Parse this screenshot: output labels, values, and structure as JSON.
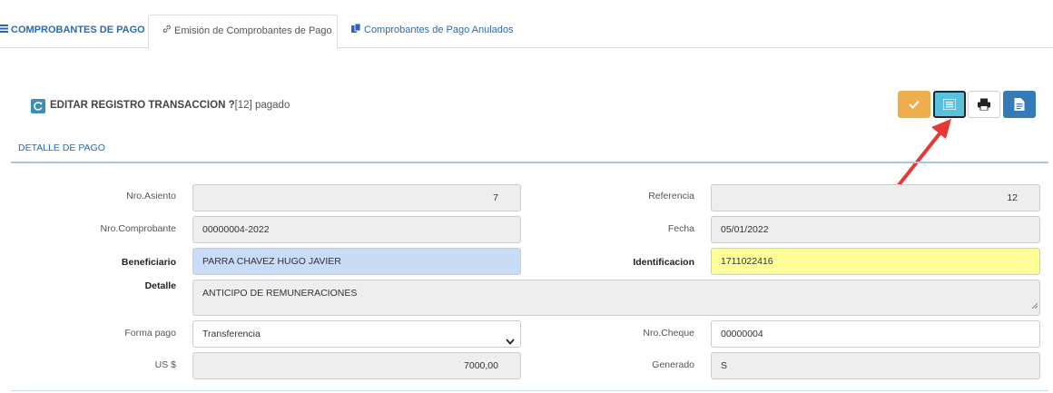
{
  "tabs": [
    {
      "label": "COMPROBANTES DE PAGO",
      "icon": "list-icon"
    },
    {
      "label": "Emisión de Comprobantes de Pago",
      "icon": "link-icon"
    },
    {
      "label": "Comprobantes de Pago Anulados",
      "icon": "copy-icon"
    }
  ],
  "header": {
    "title": "EDITAR REGISTRO TRANSACCION ?",
    "suffix": "[12] pagado",
    "icon": "refresh-icon"
  },
  "toolbar": {
    "buttons": [
      {
        "name": "confirm",
        "icon": "check-icon",
        "color": "#f0ad4e"
      },
      {
        "name": "list",
        "icon": "list-icon",
        "color": "#5bc0de"
      },
      {
        "name": "print",
        "icon": "print-icon",
        "color": "#ffffff"
      },
      {
        "name": "document",
        "icon": "document-icon",
        "color": "#337ab7"
      }
    ]
  },
  "section": {
    "title": "DETALLE DE PAGO"
  },
  "form": {
    "nro_asiento": {
      "label": "Nro.Asiento",
      "value": "7"
    },
    "referencia": {
      "label": "Referencia",
      "value": "12"
    },
    "nro_comprobante": {
      "label": "Nro.Comprobante",
      "value": "00000004-2022"
    },
    "fecha": {
      "label": "Fecha",
      "value": "05/01/2022"
    },
    "beneficiario": {
      "label": "Beneficiario",
      "value": "PARRA CHAVEZ HUGO JAVIER"
    },
    "identificacion": {
      "label": "Identificacion",
      "value": "1711022416"
    },
    "detalle": {
      "label": "Detalle",
      "value": "ANTICIPO DE REMUNERACIONES"
    },
    "forma_pago": {
      "label": "Forma pago",
      "value": "Transferencia"
    },
    "nro_cheque": {
      "label": "Nro.Cheque",
      "value": "00000004"
    },
    "us": {
      "label": "US $",
      "value": "7000,00"
    },
    "generado": {
      "label": "Generado",
      "value": "S"
    }
  },
  "colors": {
    "accent": "#2a6ab0",
    "beneficiario_bg": "#c9dcf7",
    "identificacion_bg": "#ffff99",
    "annotation_arrow": "#e53935"
  }
}
